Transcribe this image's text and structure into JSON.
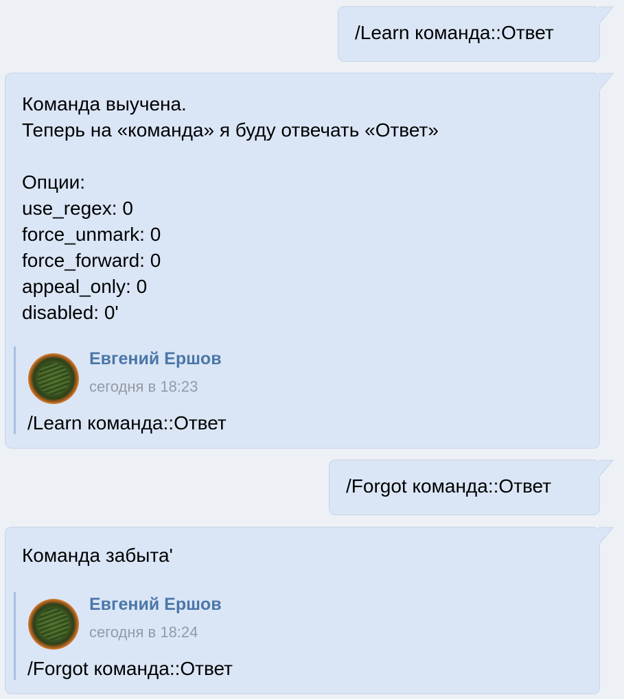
{
  "messages": [
    {
      "text": "/Learn команда::Ответ"
    },
    {
      "lines": [
        "Команда выучена.",
        "Теперь на «команда» я буду отвечать «Ответ»",
        "",
        "Опции:",
        "use_regex: 0",
        "force_unmark: 0",
        "force_forward: 0",
        "appeal_only: 0",
        "disabled: 0'"
      ],
      "quote": {
        "author": "Евгений Ершов",
        "time": "сегодня в 18:23",
        "text": "/Learn команда::Ответ"
      }
    },
    {
      "text": "/Forgot команда::Ответ"
    },
    {
      "lines": [
        "Команда забыта'"
      ],
      "quote": {
        "author": "Евгений Ершов",
        "time": "сегодня в 18:24",
        "text": "/Forgot команда::Ответ"
      }
    }
  ]
}
